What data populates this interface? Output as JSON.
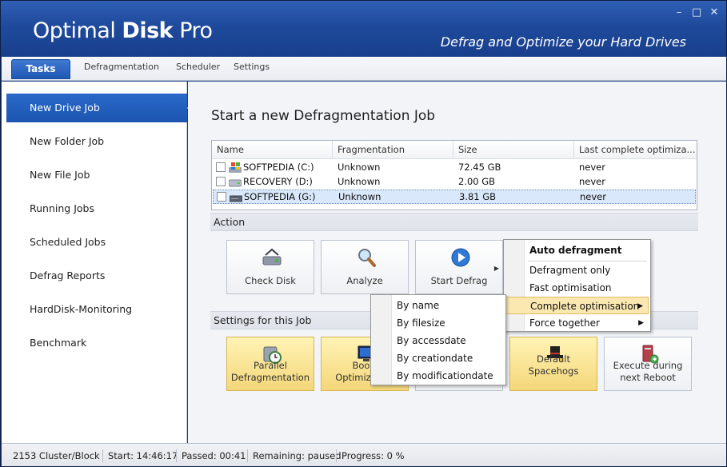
{
  "window": {
    "brand_light": "Optimal ",
    "brand_bold": "Disk",
    "brand_pro": " Pro",
    "tagline": "Defrag and Optimize your Hard Drives",
    "minimize": "–",
    "maximize": "□",
    "close": "✕"
  },
  "tabs": {
    "active": "Tasks",
    "items": [
      "Defragmentation",
      "Scheduler",
      "Settings"
    ]
  },
  "sidebar": {
    "items": [
      {
        "label": "New Drive Job"
      },
      {
        "label": "New Folder Job"
      },
      {
        "label": "New File Job"
      },
      {
        "label": "Running Jobs"
      },
      {
        "label": "Scheduled Jobs"
      },
      {
        "label": "Defrag Reports"
      },
      {
        "label": "HardDisk-Monitoring"
      },
      {
        "label": "Benchmark"
      }
    ]
  },
  "main": {
    "title": "Start a new Defragmentation Job",
    "columns": [
      "Name",
      "Fragmentation",
      "Size",
      "Last complete optimiza..."
    ],
    "drives": [
      {
        "name": "SOFTPEDIA (C:)",
        "fragmentation": "Unknown",
        "size": "72.45 GB",
        "last": "never"
      },
      {
        "name": "RECOVERY (D:)",
        "fragmentation": "Unknown",
        "size": "2.00 GB",
        "last": "never"
      },
      {
        "name": "SOFTPEDIA (G:)",
        "fragmentation": "Unknown",
        "size": "3.81 GB",
        "last": "never"
      }
    ],
    "action_label": "Action",
    "actions": [
      "Check Disk",
      "Analyze",
      "Start Defrag"
    ],
    "settings_label": "Settings for this Job",
    "settings_tiles": [
      {
        "line1": "Parallel",
        "line2": "Defragmentation"
      },
      {
        "line1": "Boott",
        "line2": "Optimization"
      },
      {
        "line1": "",
        "line2": ""
      },
      {
        "line1": "Default Spacehogs",
        "line2": ""
      },
      {
        "line1": "Execute during",
        "line2": "next Reboot"
      }
    ]
  },
  "defrag_menu": {
    "items": [
      {
        "label": "Auto defragment"
      },
      {
        "label": "Defragment only"
      },
      {
        "label": "Fast optimisation"
      },
      {
        "label": "Complete optimisation"
      },
      {
        "label": "Force together"
      }
    ]
  },
  "sort_menu": {
    "items": [
      {
        "label": "By name"
      },
      {
        "label": "By filesize"
      },
      {
        "label": "By accessdate"
      },
      {
        "label": "By creationdate"
      },
      {
        "label": "By modificationdate"
      }
    ]
  },
  "status": {
    "cluster": "2153 Cluster/Block",
    "start": "Start: 14:46:17",
    "passed": "Passed: 00:41",
    "remaining": "Remaining: paused",
    "progress": "Progress: 0 %"
  },
  "colors": {
    "title_blue": "#1f4a9c",
    "accent_blue": "#2a69c9",
    "menu_highlight": "#fbe7b0",
    "gold_tile": "#f4d77a"
  }
}
